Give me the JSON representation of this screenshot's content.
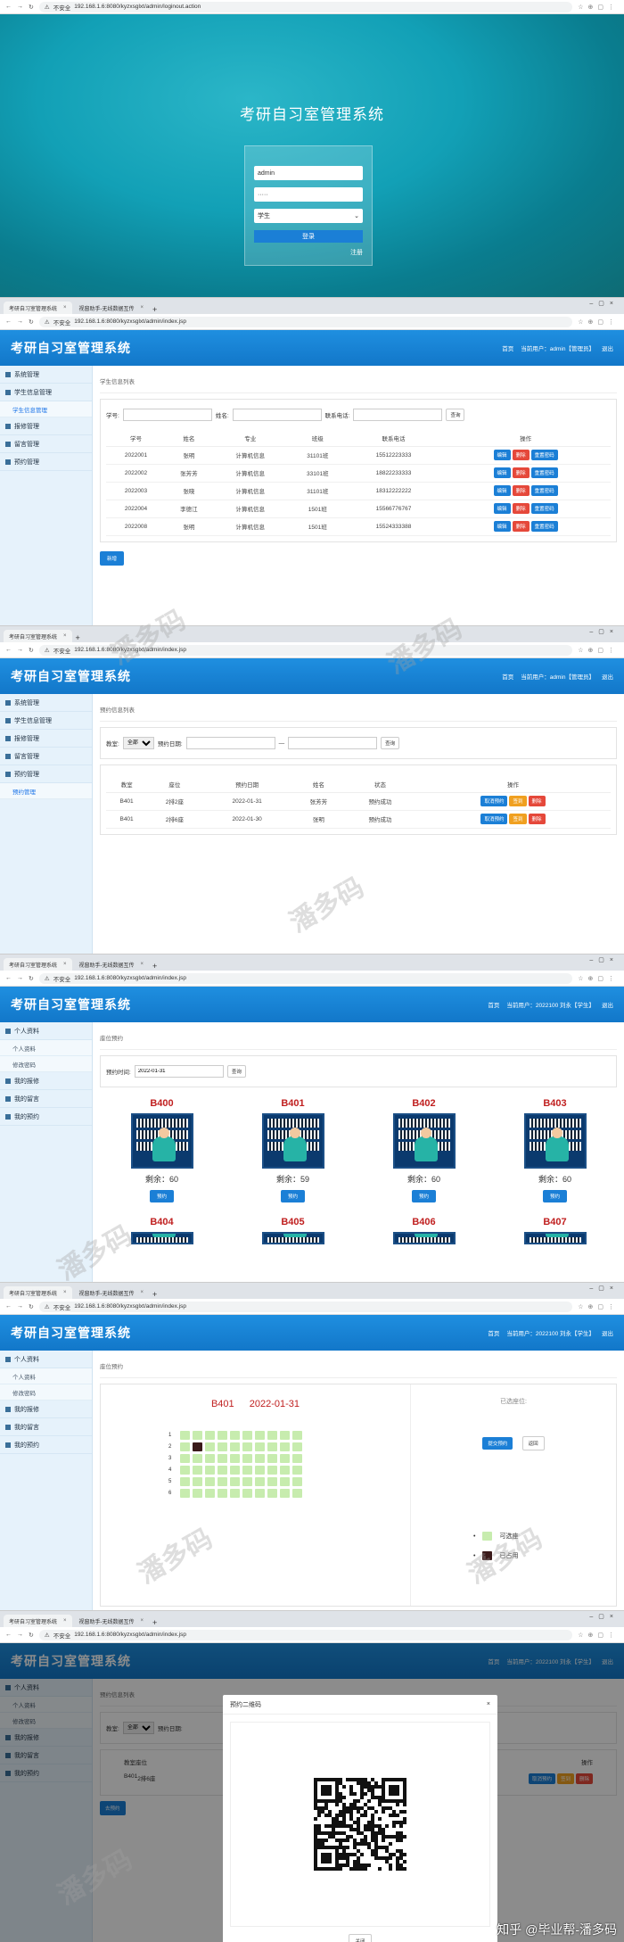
{
  "login": {
    "url": "192.168.1.6:8080/kyzxsglxt/admin/loginout.action",
    "insecure": "不安全",
    "title": "考研自习室管理系统",
    "username": "admin",
    "password": "·····",
    "role": "学生",
    "login_btn": "登录",
    "register": "注册"
  },
  "common": {
    "tab1": "考研自习室管理系统",
    "tab2": "视窗助手-无线数据互传",
    "url": "192.168.1.6:8080/kyzxsglxt/admin/index.jsp",
    "app_title": "考研自习室管理系统",
    "home": "首页",
    "logout": "退出"
  },
  "admin_user": "当前用户：admin【管理员】",
  "admin_menu": [
    "系统管理",
    "学生信息管理",
    "学生信息管理",
    "报修管理",
    "留言管理",
    "预约管理"
  ],
  "students": {
    "crumb": "学生信息列表",
    "lbl_no": "学号:",
    "lbl_name": "姓名:",
    "lbl_phone": "联系电话:",
    "search": "查询",
    "headers": [
      "学号",
      "姓名",
      "专业",
      "班级",
      "联系电话",
      "操作"
    ],
    "rows": [
      [
        "2022001",
        "张明",
        "计算机信息",
        "31101班",
        "15512223333"
      ],
      [
        "2022002",
        "张芳芳",
        "计算机信息",
        "33101班",
        "18822233333"
      ],
      [
        "2022003",
        "张晓",
        "计算机信息",
        "31101班",
        "18312222222"
      ],
      [
        "2022004",
        "李德江",
        "计算机信息",
        "1501班",
        "15566776767"
      ],
      [
        "2022008",
        "张明",
        "计算机信息",
        "1501班",
        "15524333388"
      ]
    ],
    "ops": [
      "编辑",
      "删除",
      "重置密码"
    ],
    "add": "新增"
  },
  "reservations": {
    "crumb": "预约信息列表",
    "lbl_room": "教室:",
    "room_val": "全部",
    "lbl_date": "预约日期:",
    "dash": "—",
    "search": "查询",
    "headers": [
      "教室",
      "座位",
      "预约日期",
      "姓名",
      "状态",
      "操作"
    ],
    "rows": [
      [
        "B401",
        "2排2座",
        "2022-01-31",
        "张芳芳",
        "预约成功"
      ],
      [
        "B401",
        "2排6座",
        "2022-01-30",
        "张明",
        "预约成功"
      ]
    ],
    "ops": [
      "取消预约",
      "签到",
      "删除"
    ],
    "menu_sub": "预约管理"
  },
  "student_user": "当前用户：2022100 刘永【学生】",
  "student_menu": {
    "profile": "个人资料",
    "sub1": "个人资料",
    "sub2": "修改密码",
    "repair": "我的报修",
    "msg": "我的留言",
    "resv": "我的预约"
  },
  "booking": {
    "crumb": "座位预约",
    "lbl_time": "预约时间:",
    "date": "2022-01-31",
    "search": "查询",
    "rooms": [
      {
        "name": "B400",
        "remain": "剩余：60"
      },
      {
        "name": "B401",
        "remain": "剩余：59"
      },
      {
        "name": "B402",
        "remain": "剩余：60"
      },
      {
        "name": "B403",
        "remain": "剩余：60"
      }
    ],
    "rooms2": [
      "B404",
      "B405",
      "B406",
      "B407"
    ],
    "book": "预约"
  },
  "seatpick": {
    "crumb": "座位预约",
    "room": "B401",
    "date": "2022-01-31",
    "selected": "已选座位:",
    "confirm": "提交预约",
    "back": "返回",
    "legend_free": "可选座",
    "legend_taken": "已占用",
    "rows": [
      "1",
      "2",
      "3",
      "4",
      "5",
      "6"
    ]
  },
  "qr": {
    "title": "预约二维码",
    "close": "关闭",
    "room": "B401",
    "seat": "2排6座",
    "headers": [
      "教室",
      "座位"
    ],
    "op_label": "操作",
    "resv_btn": "去预约"
  },
  "watermark": "潘多码",
  "footer_wm": "知乎 @毕业帮-潘多码"
}
